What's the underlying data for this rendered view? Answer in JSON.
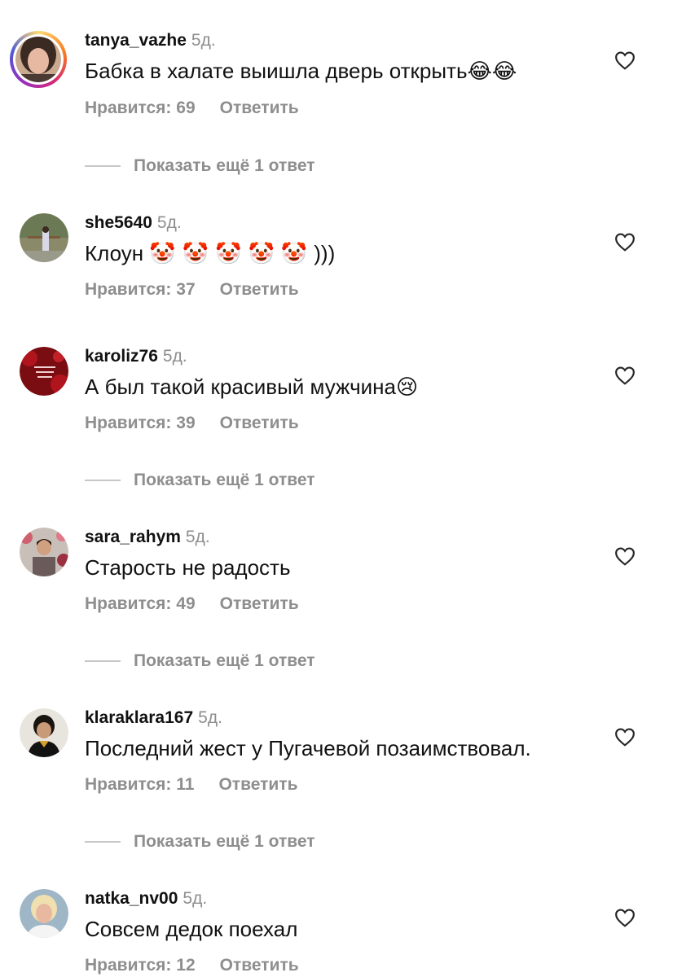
{
  "comments": [
    {
      "username": "tanya_vazhe",
      "time": "5д.",
      "text": "Бабка в халате выишла дверь открыть",
      "text_emoji": "😂😂",
      "likes": "Нравится: 69",
      "reply": "Ответить",
      "more_replies": "Показать ещё 1 ответ"
    },
    {
      "username": "she5640",
      "time": "5д.",
      "text": "Клоун",
      "text_emoji": "🤡🤡🤡🤡🤡",
      "text_suffix": ")))",
      "likes": "Нравится: 37",
      "reply": "Ответить"
    },
    {
      "username": "karoliz76",
      "time": "5д.",
      "text": "А был такой красивый мужчина",
      "text_emoji": "😢",
      "likes": "Нравится: 39",
      "reply": "Ответить",
      "more_replies": "Показать ещё 1 ответ"
    },
    {
      "username": "sara_rahym",
      "time": "5д.",
      "text": "Старость не радость",
      "likes": "Нравится: 49",
      "reply": "Ответить",
      "more_replies": "Показать ещё 1 ответ"
    },
    {
      "username": "klaraklara167",
      "time": "5д.",
      "text": "Последний жест у Пугачевой позаимствовал.",
      "likes": "Нравится: 11",
      "reply": "Ответить",
      "more_replies": "Показать ещё 1 ответ"
    },
    {
      "username": "natka_nv00",
      "time": "5д.",
      "text": "Совсем дедок поехал",
      "likes": "Нравится: 12",
      "reply": "Ответить"
    }
  ],
  "icons": {
    "like": "heart-outline-icon"
  },
  "colors": {
    "secondary_text": "#8e8e8e",
    "primary_text": "#111111"
  }
}
